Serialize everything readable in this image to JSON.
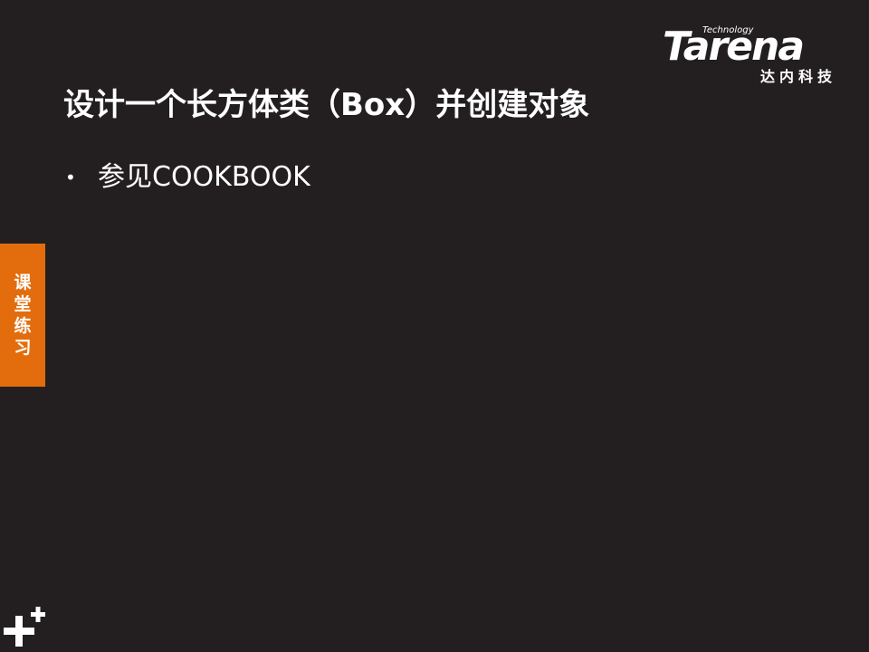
{
  "logo": {
    "technology": "Technology",
    "brand": "Tarena",
    "cn": "达内科技"
  },
  "slide": {
    "title": "设计一个长方体类（Box）并创建对象",
    "bullets": [
      "参见COOKBOOK"
    ]
  },
  "side_tab": {
    "chars": [
      "课",
      "堂",
      "练",
      "习"
    ]
  },
  "colors": {
    "background": "#231f20",
    "accent": "#e36d0d",
    "text": "#ffffff"
  },
  "decor": {
    "corner_icon": "plus-plus-icon"
  }
}
